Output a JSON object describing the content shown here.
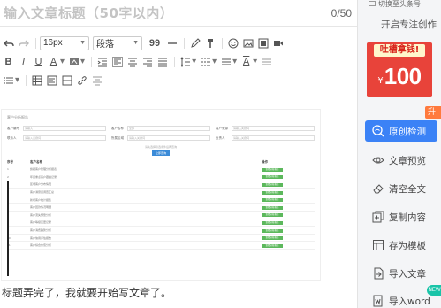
{
  "editor": {
    "title_placeholder": "输入文章标题（50字以内）",
    "title_counter": "0/50",
    "toolbar": {
      "font_size": "16px",
      "paragraph": "段落",
      "quote_mark": "99"
    },
    "body_text": "标题弄完了，我就要开始写文章了。",
    "embedded_doc": {
      "title": "客户分析报告",
      "form_rows": [
        [
          {
            "label": "客户编号",
            "value": "请输入"
          },
          {
            "label": "客户名称",
            "value": "全部"
          },
          {
            "label": "客户来源",
            "value": "请输入关键词"
          }
        ],
        [
          {
            "label": "联系人",
            "value": "请输入关键词"
          },
          {
            "label": "所属区域",
            "value": "请输入关键词"
          },
          {
            "label": "负责人",
            "value": "请输入关键词"
          }
        ]
      ],
      "hint": "请先选择筛选条件后再查询",
      "search_button": "立即查询",
      "columns": [
        "序号",
        "客户名称",
        "操作"
      ],
      "rows": [
        {
          "no": "1",
          "name": "旗舰客户管理分析报表",
          "action": "查看分析报告"
        },
        {
          "no": "2",
          "name": "年度重点客户跟进记录",
          "action": "查看分析报告"
        },
        {
          "no": "3",
          "name": "区域客户分布情况",
          "action": "查看分析报告"
        },
        {
          "no": "4",
          "name": "客户满意度调查汇总",
          "action": "查看分析报告"
        },
        {
          "no": "5",
          "name": "新增客户统计报表",
          "action": "查看分析报告"
        },
        {
          "no": "6",
          "name": "客户回款情况明细",
          "action": "查看分析报告"
        },
        {
          "no": "7",
          "name": "客户流失预警分析",
          "action": "查看分析报告"
        },
        {
          "no": "8",
          "name": "客户等级变更记录",
          "action": "查看分析报告"
        },
        {
          "no": "9",
          "name": "客户消费趋势分析",
          "action": "查看分析报告"
        },
        {
          "no": "10",
          "name": "客户信用评估报告",
          "action": "查看分析报告"
        },
        {
          "no": "11",
          "name": "客户综合价值分析",
          "action": "查看分析报告"
        }
      ]
    }
  },
  "sidebar": {
    "top_label": "切换至头条号",
    "slogan": "开启专注创作",
    "promo": {
      "tag": "吐槽拿钱!",
      "currency": "¥",
      "amount": "100"
    },
    "upgrade_tag": "升级",
    "items": [
      {
        "label": "原创检测",
        "icon": "original-check-icon"
      },
      {
        "label": "文章预览",
        "icon": "eye-icon"
      },
      {
        "label": "清空全文",
        "icon": "eraser-icon"
      },
      {
        "label": "复制内容",
        "icon": "copy-icon"
      },
      {
        "label": "存为模板",
        "icon": "template-icon"
      },
      {
        "label": "导入文章",
        "icon": "import-icon"
      },
      {
        "label": "导入word",
        "icon": "word-import-icon"
      }
    ],
    "new_badge": "NEW",
    "accent_color": "#3b82f6",
    "promo_color": "#e8433a"
  }
}
